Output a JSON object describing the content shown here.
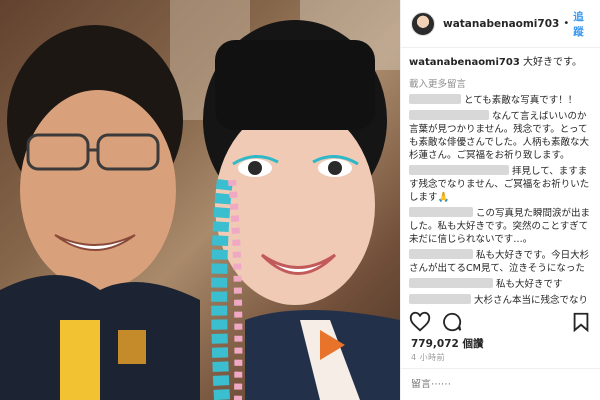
{
  "post": {
    "username": "watanabenaomi703",
    "follow_label": "追蹤",
    "caption_user": "watanabenaomi703",
    "caption_text": "大好きです。",
    "load_more": "載入更多留言",
    "likes": "779,072 個讚",
    "time": "4 小時前",
    "comment_placeholder": "留言⋯⋯"
  },
  "comments": [
    {
      "text": "とても素敵な写真です！！"
    },
    {
      "text": "なんて言えばいいのか言葉が見つかりません。残念です。とっても素敵な俳優さんでした。人柄も素敵な大杉蓮さん。ご冥福をお祈り致します。"
    },
    {
      "text": "拝見して、ますます残念でなりません、ご冥福をお祈りいたします🙏"
    },
    {
      "text": "この写真見た瞬間涙が出ました。私も大好きです。突然のことすぎて未だに信じられないです…。"
    },
    {
      "text": "私も大好きです。今日大杉さんが出てるCM見て、泣きそうになった"
    },
    {
      "text": "私も大好きです"
    },
    {
      "text": "大杉さん本当に残念でなり"
    }
  ],
  "icons": {
    "like": "heart-icon",
    "comment": "comment-icon",
    "save": "bookmark-icon",
    "follow_dot": "bullet"
  }
}
